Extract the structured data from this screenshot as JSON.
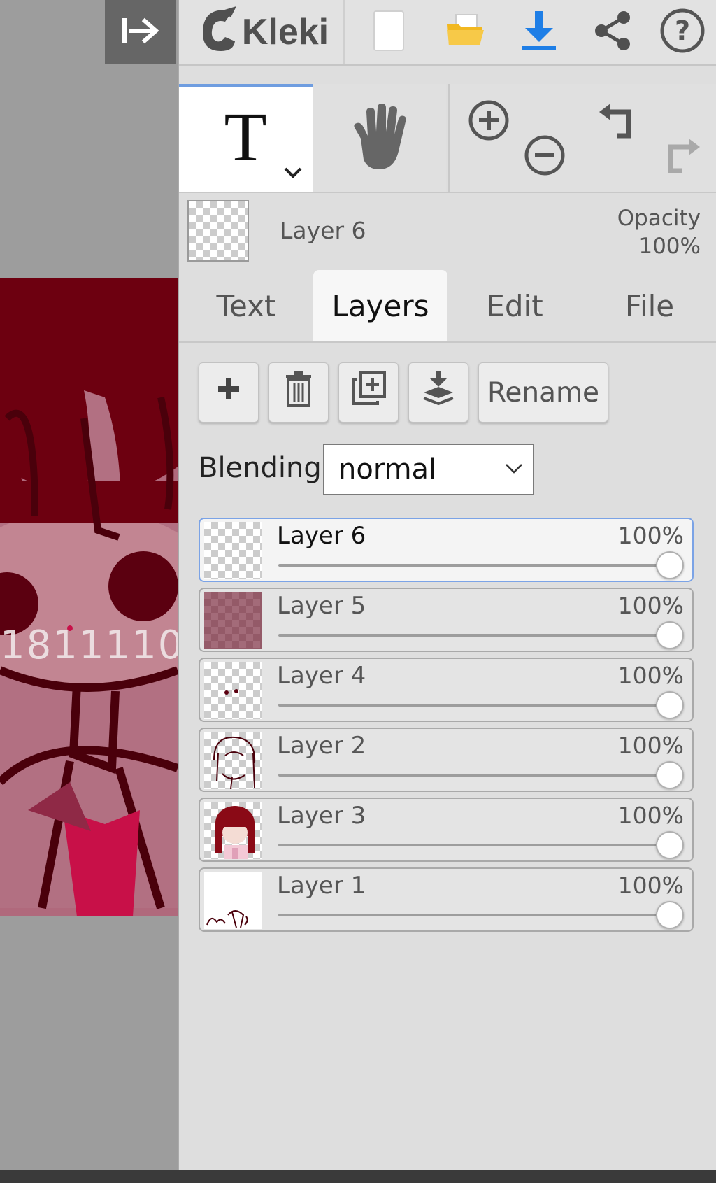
{
  "app": {
    "title": "Kleki"
  },
  "topbar": {
    "collapse_icon": "collapse-panel-icon",
    "icons": [
      "new-image-icon",
      "open-folder-icon",
      "download-icon",
      "share-icon",
      "help-icon"
    ],
    "colors": {
      "folder": "#f2b820",
      "download": "#1e7ee6"
    }
  },
  "tools": {
    "active": "text",
    "items": [
      "text-tool",
      "hand-tool",
      "zoom-in",
      "zoom-out",
      "undo",
      "redo"
    ]
  },
  "current_layer": {
    "name": "Layer 6",
    "opacity_label": "Opacity",
    "opacity_value": "100%"
  },
  "tabs": [
    {
      "label": "Text",
      "active": false
    },
    {
      "label": "Layers",
      "active": true
    },
    {
      "label": "Edit",
      "active": false
    },
    {
      "label": "File",
      "active": false
    }
  ],
  "layer_actions": {
    "add_icon": "plus-icon",
    "delete_icon": "trash-icon",
    "duplicate_icon": "duplicate-icon",
    "merge_icon": "merge-down-icon",
    "rename_label": "Rename"
  },
  "blending": {
    "label": "Blending",
    "value": "normal"
  },
  "layers": [
    {
      "name": "Layer 6",
      "opacity": "100%",
      "opacity_fraction": 1.0,
      "active": true
    },
    {
      "name": "Layer 5",
      "opacity": "100%",
      "opacity_fraction": 1.0,
      "active": false
    },
    {
      "name": "Layer 4",
      "opacity": "100%",
      "opacity_fraction": 1.0,
      "active": false
    },
    {
      "name": "Layer 2",
      "opacity": "100%",
      "opacity_fraction": 1.0,
      "active": false
    },
    {
      "name": "Layer 3",
      "opacity": "100%",
      "opacity_fraction": 1.0,
      "active": false
    },
    {
      "name": "Layer 1",
      "opacity": "100%",
      "opacity_fraction": 1.0,
      "active": false
    }
  ],
  "canvas": {
    "overlay_text": "1811110"
  },
  "accent": "#6f9de0"
}
